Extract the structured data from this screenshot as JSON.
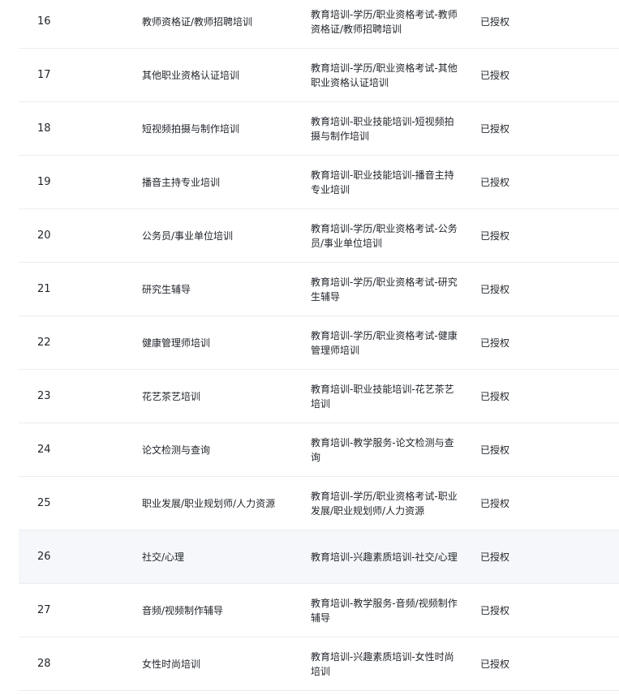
{
  "table": {
    "rows": [
      {
        "index": "16",
        "name": "教师资格证/教师招聘培训",
        "category_path": "教育培训-学历/职业资格考试-教师资格证/教师招聘培训",
        "status": "已授权"
      },
      {
        "index": "17",
        "name": "其他职业资格认证培训",
        "category_path": "教育培训-学历/职业资格考试-其他职业资格认证培训",
        "status": "已授权"
      },
      {
        "index": "18",
        "name": "短视频拍摄与制作培训",
        "category_path": "教育培训-职业技能培训-短视频拍摄与制作培训",
        "status": "已授权"
      },
      {
        "index": "19",
        "name": "播音主持专业培训",
        "category_path": "教育培训-职业技能培训-播音主持专业培训",
        "status": "已授权"
      },
      {
        "index": "20",
        "name": "公务员/事业单位培训",
        "category_path": "教育培训-学历/职业资格考试-公务员/事业单位培训",
        "status": "已授权"
      },
      {
        "index": "21",
        "name": "研究生辅导",
        "category_path": "教育培训-学历/职业资格考试-研究生辅导",
        "status": "已授权"
      },
      {
        "index": "22",
        "name": "健康管理师培训",
        "category_path": "教育培训-学历/职业资格考试-健康管理师培训",
        "status": "已授权"
      },
      {
        "index": "23",
        "name": "花艺茶艺培训",
        "category_path": "教育培训-职业技能培训-花艺茶艺培训",
        "status": "已授权"
      },
      {
        "index": "24",
        "name": "论文检测与查询",
        "category_path": "教育培训-教学服务-论文检测与查询",
        "status": "已授权"
      },
      {
        "index": "25",
        "name": "职业发展/职业规划师/人力资源",
        "category_path": "教育培训-学历/职业资格考试-职业发展/职业规划师/人力资源",
        "status": "已授权"
      },
      {
        "index": "26",
        "name": "社交/心理",
        "category_path": "教育培训-兴趣素质培训-社交/心理",
        "status": "已授权"
      },
      {
        "index": "27",
        "name": "音频/视频制作辅导",
        "category_path": "教育培训-教学服务-音频/视频制作辅导",
        "status": "已授权"
      },
      {
        "index": "28",
        "name": "女性时尚培训",
        "category_path": "教育培训-兴趣素质培训-女性时尚培训",
        "status": "已授权"
      }
    ]
  },
  "colors": {
    "text": "#1f2329",
    "divider": "#ebedf0",
    "hover_row": "#f5f7fa"
  }
}
